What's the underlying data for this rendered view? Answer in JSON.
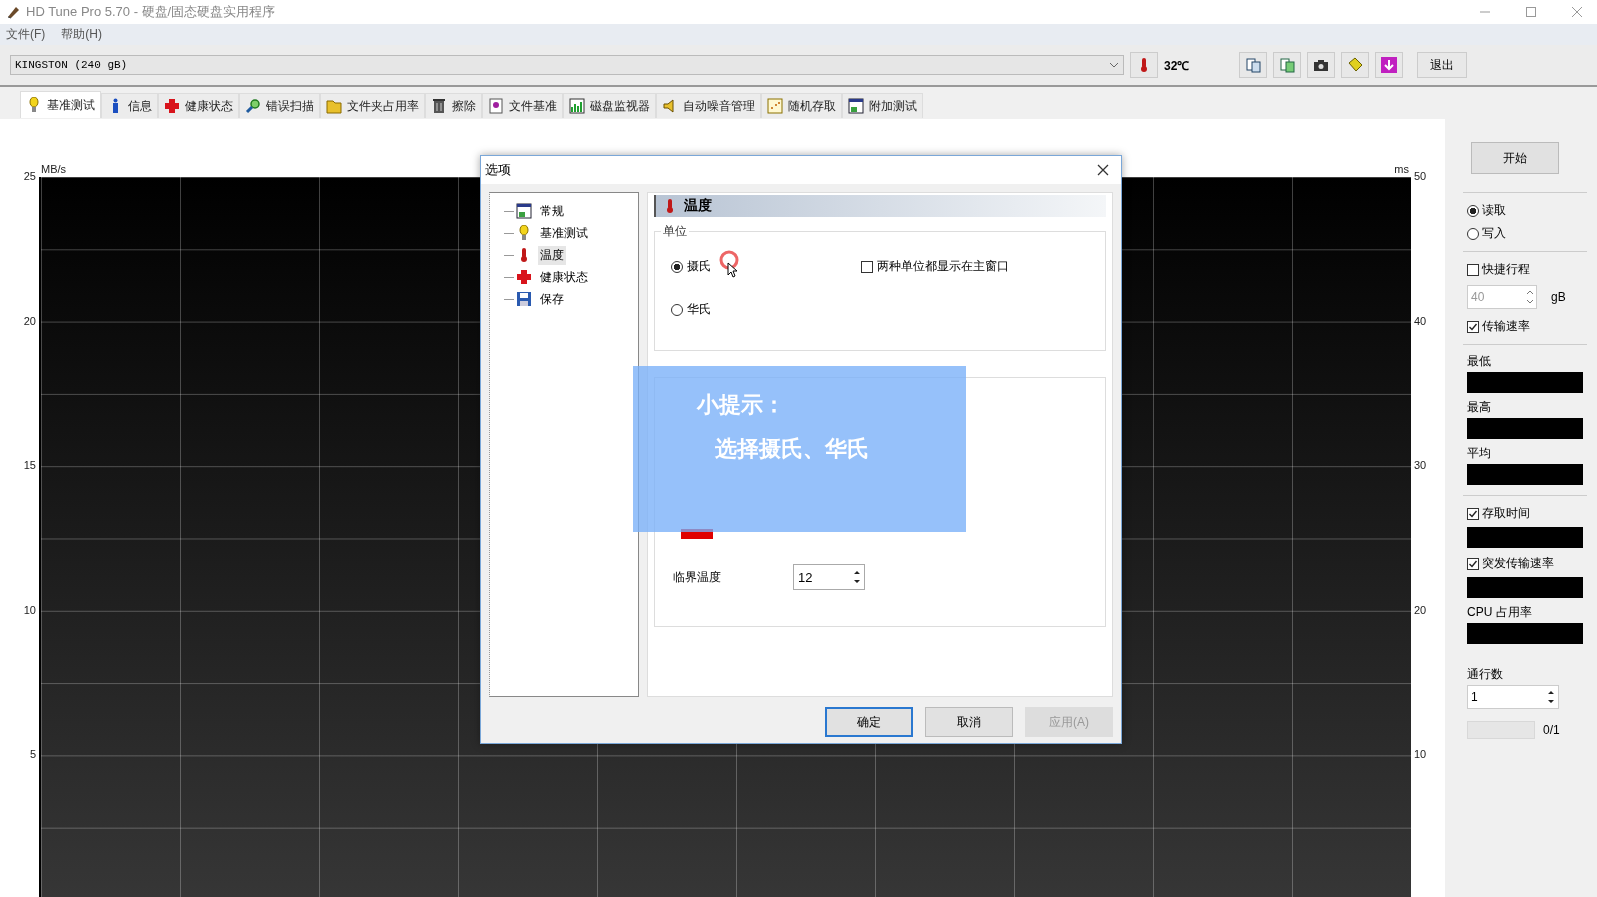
{
  "window": {
    "title": "HD Tune Pro 5.70 - 硬盘/固态硬盘实用程序"
  },
  "menu": [
    "文件(F)",
    "帮助(H)"
  ],
  "drive": {
    "value": "KINGSTON (240 gB)",
    "temperature": "32℃",
    "exit_button": "退出"
  },
  "tabs": [
    {
      "label": "基准测试",
      "selected": true
    },
    {
      "label": "信息",
      "selected": false
    },
    {
      "label": "健康状态",
      "selected": false
    },
    {
      "label": "错误扫描",
      "selected": false
    },
    {
      "label": "文件夹占用率",
      "selected": false
    },
    {
      "label": "擦除",
      "selected": false
    },
    {
      "label": "文件基准",
      "selected": false
    },
    {
      "label": "磁盘监视器",
      "selected": false
    },
    {
      "label": "自动噪音管理",
      "selected": false
    },
    {
      "label": "随机存取",
      "selected": false
    },
    {
      "label": "附加测试",
      "selected": false
    }
  ],
  "chart": {
    "left_unit": "MB/s",
    "right_unit": "ms",
    "left_ticks": [
      "25",
      "20",
      "15",
      "10",
      "5"
    ],
    "right_ticks": [
      "50",
      "40",
      "30",
      "20",
      "10"
    ]
  },
  "side_panel": {
    "start_button": "开始",
    "modes": [
      {
        "label": "读取",
        "selected": true
      },
      {
        "label": "写入",
        "selected": false
      }
    ],
    "short_stroke": {
      "label": "快捷行程",
      "checked": false
    },
    "stroke_value": "40",
    "stroke_unit": "gB",
    "transfer_rate": {
      "label": "传输速率",
      "checked": true
    },
    "stats": [
      "最低",
      "最高",
      "平均"
    ],
    "access_time": {
      "label": "存取时间",
      "checked": true
    },
    "burst_rate": {
      "label": "突发传输速率",
      "checked": true
    },
    "cpu_label": "CPU 占用率",
    "passes_label": "通行数",
    "passes_value": "1",
    "progress_text": "0/1"
  },
  "dialog": {
    "title": "选项",
    "tree": [
      {
        "label": "常规",
        "selected": false
      },
      {
        "label": "基准测试",
        "selected": false
      },
      {
        "label": "温度",
        "selected": true
      },
      {
        "label": "健康状态",
        "selected": false
      },
      {
        "label": "保存",
        "selected": false
      }
    ],
    "header": "温度",
    "unit_group": "单位",
    "units": [
      {
        "label": "摄氏",
        "selected": true
      },
      {
        "label": "华氏",
        "selected": false
      }
    ],
    "both_units": {
      "label": "两种单位都显示在主窗口",
      "checked": false
    },
    "critical_label": "临界温度",
    "critical_value": "12",
    "buttons": [
      {
        "label": "确定",
        "kind": "default"
      },
      {
        "label": "取消",
        "kind": "normal"
      },
      {
        "label": "应用(A)",
        "kind": "disabled"
      }
    ]
  },
  "tip": {
    "title": "小提示：",
    "text": "选择摄氏、华氏"
  }
}
